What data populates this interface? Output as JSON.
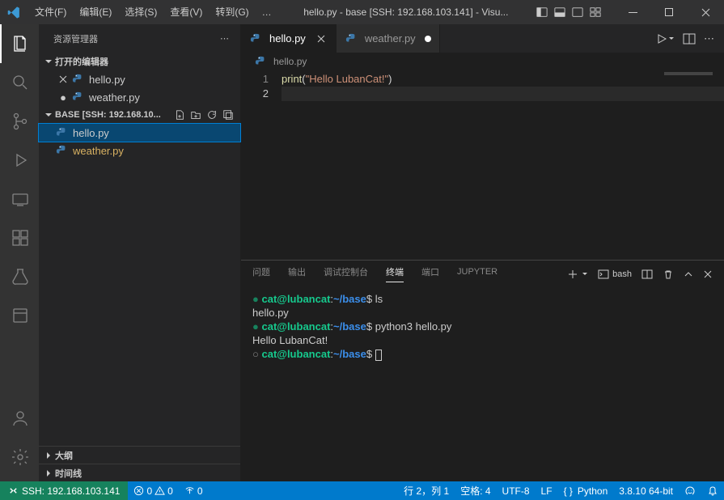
{
  "titlebar": {
    "menus": [
      "文件(F)",
      "编辑(E)",
      "选择(S)",
      "查看(V)",
      "转到(G)",
      "…"
    ],
    "title": "hello.py - base [SSH: 192.168.103.141] - Visu..."
  },
  "sidebar": {
    "title": "资源管理器",
    "openEditors": {
      "label": "打开的编辑器"
    },
    "openItems": [
      {
        "name": "hello.py",
        "close": true
      },
      {
        "name": "weather.py",
        "dot": true
      }
    ],
    "workspace": {
      "label": "BASE [SSH: 192.168.10..."
    },
    "files": [
      {
        "name": "hello.py",
        "selected": true,
        "mod": false
      },
      {
        "name": "weather.py",
        "selected": false,
        "mod": true
      }
    ],
    "outline": "大纲",
    "timeline": "时间线"
  },
  "tabs": [
    {
      "name": "hello.py",
      "active": true,
      "dirty": false
    },
    {
      "name": "weather.py",
      "active": false,
      "dirty": true
    }
  ],
  "breadcrumb": "hello.py",
  "code": {
    "line1": {
      "fn": "print",
      "p1": "(",
      "str": "\"Hello LubanCat!\"",
      "p2": ")"
    },
    "lineNums": [
      "1",
      "2"
    ]
  },
  "panel": {
    "tabs": [
      "问题",
      "输出",
      "调试控制台",
      "终端",
      "端口",
      "JUPYTER"
    ],
    "shell": "bash"
  },
  "terminal": {
    "user": "cat@lubancat",
    "path": "~/base",
    "lines": [
      {
        "type": "prompt",
        "cmd": "ls",
        "bullet": "●"
      },
      {
        "type": "out",
        "text": "hello.py"
      },
      {
        "type": "prompt",
        "cmd": "python3 hello.py",
        "bullet": "●"
      },
      {
        "type": "out",
        "text": "Hello LubanCat!"
      },
      {
        "type": "prompt",
        "cmd": "",
        "bullet": "○",
        "cursor": true
      }
    ]
  },
  "status": {
    "ssh": "SSH: 192.168.103.141",
    "errors": "0",
    "warnings": "0",
    "radio": "0",
    "line": "行 2，列 1",
    "spaces": "空格: 4",
    "encoding": "UTF-8",
    "eol": "LF",
    "lang": "Python",
    "py": "3.8.10 64-bit"
  }
}
